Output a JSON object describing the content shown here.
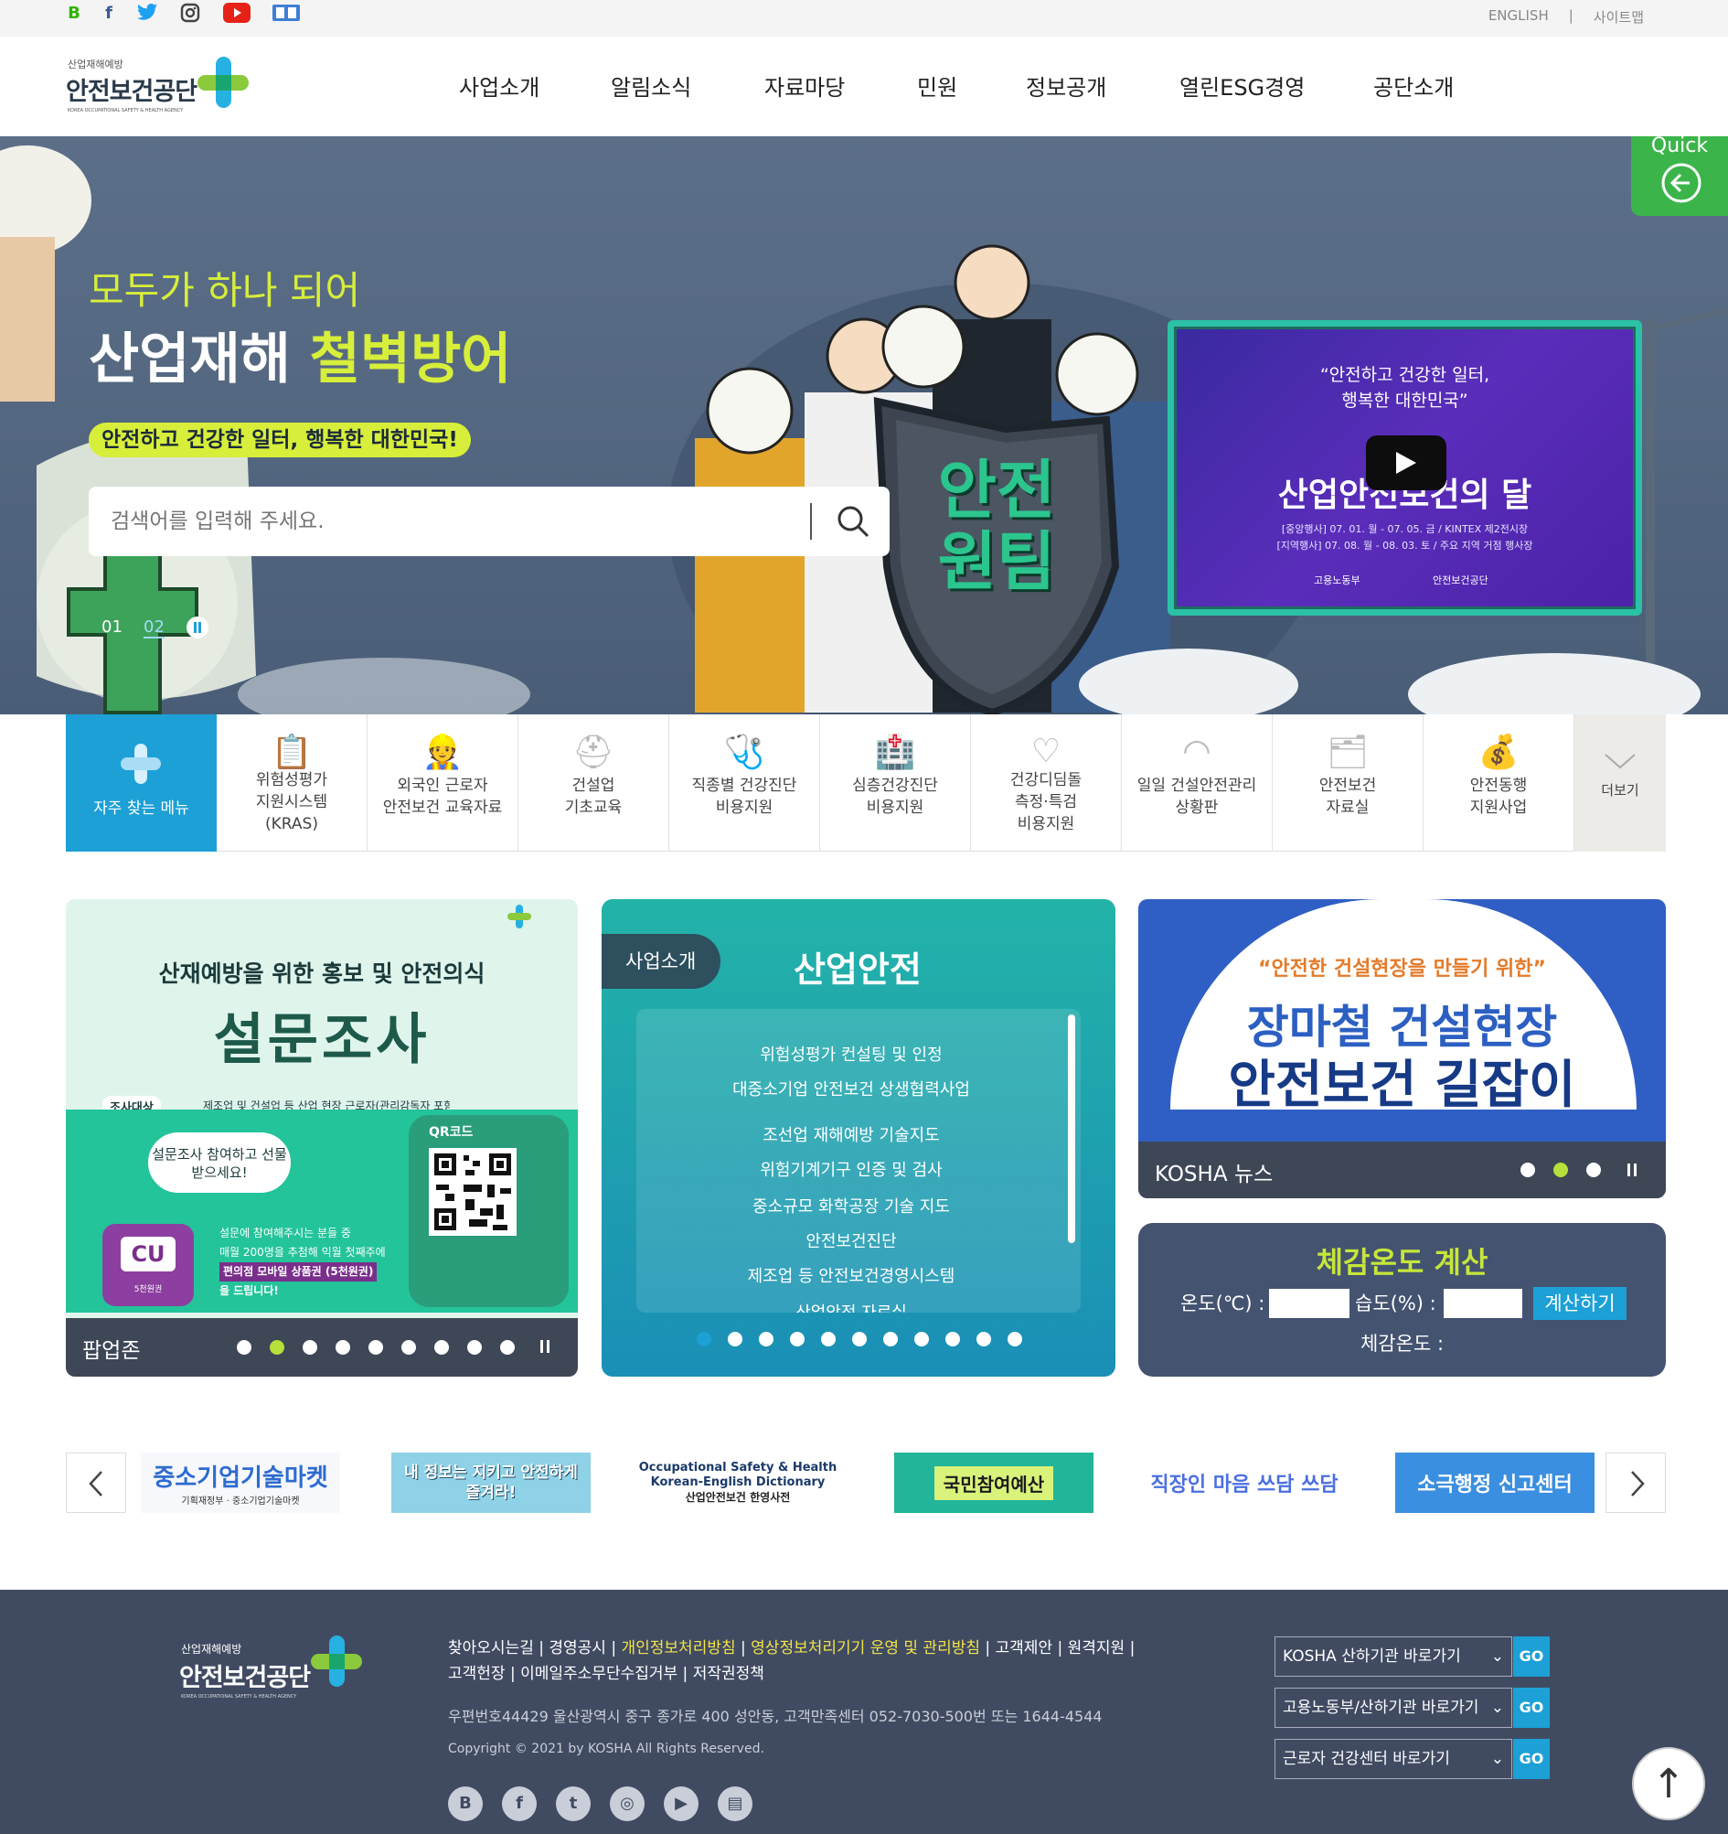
{
  "topbar": {
    "social": [
      {
        "name": "blog",
        "glyph": "B",
        "color": "#2db400"
      },
      {
        "name": "facebook",
        "glyph": "f",
        "color": "#3b5998"
      },
      {
        "name": "twitter",
        "glyph": "t",
        "color": "#1da1f2"
      },
      {
        "name": "instagram",
        "glyph": "◎",
        "color": "#555555"
      },
      {
        "name": "youtube",
        "glyph": "▶",
        "color": "#e62117"
      },
      {
        "name": "book",
        "glyph": "▤",
        "color": "#3f7fd4"
      }
    ],
    "util_links": [
      "ENGLISH",
      "|",
      "사이트맵"
    ]
  },
  "header": {
    "logo_top": "산업재해예방",
    "logo_main": "안전보건공단",
    "logo_en": "KOREA OCCUPATIONAL SAFETY & HEALTH AGENCY",
    "nav": [
      "사업소개",
      "알림소식",
      "자료마당",
      "민원",
      "정보공개",
      "열린ESG경영",
      "공단소개"
    ]
  },
  "hero": {
    "subtitle": "모두가 하나 되어",
    "title_prefix": "산업재해 ",
    "title_highlight": "철벽방어",
    "pill": "안전하고 건강한 일터, 행복한 대한민국!",
    "search_placeholder": "검색어를 입력해 주세요.",
    "slides": [
      "01",
      "02"
    ],
    "active_slide": "02",
    "shield_text_1": "안전",
    "shield_text_2": "원팀",
    "quick_label": "Quick",
    "video": {
      "quote_line1": "“안전하고 건강한 일터,",
      "quote_line2": "행복한 대한민국”",
      "title": "산업안전보건의 달",
      "event1": "[중앙행사] 07. 01. 월 - 07. 05. 금 / KINTEX 제2전시장",
      "event2": "[지역행사] 07. 08. 월 - 08. 03. 토 / 주요 지역 거점 행사장",
      "org1": "고용노동부",
      "org2": "안전보건공단"
    }
  },
  "quickmenu": {
    "head_label": "자주 찾는 메뉴",
    "items": [
      {
        "label": "위험성평가\n지원시스템\n(KRAS)",
        "icon": "clipboard-icon",
        "glyph": "📋"
      },
      {
        "label": "외국인 근로자\n안전보건 교육자료",
        "icon": "foreign-worker-icon",
        "glyph": "👷"
      },
      {
        "label": "건설업\n기초교육",
        "icon": "hardhat-icon",
        "glyph": "⛑"
      },
      {
        "label": "직종별 건강진단\n비용지원",
        "icon": "stethoscope-icon",
        "glyph": "🩺"
      },
      {
        "label": "심층건강진단\n비용지원",
        "icon": "hospital-icon",
        "glyph": "🏥"
      },
      {
        "label": "건강디딤돌\n측정·특검\n비용지원",
        "icon": "heartbeat-icon",
        "glyph": "♡"
      },
      {
        "label": "일일 건설안전관리\n상황판",
        "icon": "gauge-icon",
        "glyph": "◠"
      },
      {
        "label": "안전보건\n자료실",
        "icon": "folder-icon",
        "glyph": "🗂"
      },
      {
        "label": "안전동행\n지원사업",
        "icon": "money-hand-icon",
        "glyph": "💰"
      }
    ],
    "more_label": "더보기"
  },
  "popup": {
    "headline": "산재예방을 위한 홍보 및 안전의식",
    "big_title": "설문조사",
    "survey_tag": "조사대상",
    "desc_partial": "제조업 및 건설업 등 산업 현장 근로자(관리감독자 포함)",
    "qr_label": "QR코드",
    "bubble": "설문조사 참여하고 선물 받으세요!",
    "gift_text_1": "설문에 참여해주시는 분들 중",
    "gift_text_2": "매월 200명을 추첨해 익월 첫째주에",
    "gift_text_3": "편의점 모바일 상품권 (5천원권)",
    "gift_text_4": "을 드립니다!",
    "cu_label": "CU",
    "cu_sub": "5천원권",
    "zone_label": "팝업존",
    "dots": 9,
    "active_dot": 2
  },
  "biz": {
    "tag": "사업소개",
    "title": "산업안전",
    "items": [
      "위험성평가 컨설팅 및 인정",
      "대중소기업 안전보건 상생협력사업",
      "조선업 재해예방 기술지도",
      "위험기계기구 인증 및 검사",
      "중소규모 화학공장 기술 지도",
      "안전보건진단",
      "제조업 등 안전보건경영시스템",
      "산업안전 자료실"
    ],
    "dots": 11,
    "active_dot": 1
  },
  "news": {
    "sub": "“안전한 건설현장을 만들기 위한”",
    "title1": "장마철 건설현장",
    "title2": "안전보건 길잡이",
    "label": "KOSHA 뉴스",
    "dots": 3,
    "active_dot": 2
  },
  "calc": {
    "title": "체감온도 계산",
    "temp_label": "온도(℃) :",
    "humid_label": "습도(%) :",
    "button": "계산하기",
    "result_label": "체감온도 :"
  },
  "banners": [
    {
      "text": "중소기업기술마켓",
      "sub": "기획재정부 · 중소기업기술마켓"
    },
    {
      "text": "내 정보는 지키고 안전하게 즐겨라!",
      "sub": ""
    },
    {
      "text": "Occupational Safety & Health Korean-English Dictionary",
      "sub": "산업안전보건 한영사전"
    },
    {
      "text": "국민참여예산",
      "sub": ""
    },
    {
      "text": "직장인 마음 쓰담 쓰담",
      "sub": ""
    },
    {
      "text": "소극행정 신고센터",
      "sub": ""
    }
  ],
  "footer": {
    "logo_top": "산업재해예방",
    "logo_main": "안전보건공단",
    "logo_en": "KOREA OCCUPATIONAL SAFETY & HEALTH AGENCY",
    "links": [
      "찾아오시는길",
      "경영공시",
      "개인정보처리방침",
      "영상정보처리기기 운영 및 관리방침",
      "고객제안",
      "원격지원",
      "고객헌장",
      "이메일주소무단수집거부",
      "저작권정책"
    ],
    "address": "우편번호44429 울산광역시 중구 종가로 400 성안동, 고객만족센터 052-7030-500번 또는 1644-4544",
    "copyright": "Copyright © 2021 by KOSHA All Rights Reserved.",
    "selects": [
      "KOSHA 산하기관 바로가기",
      "고용노동부/산하기관 바로가기",
      "근로자 건강센터 바로가기"
    ],
    "go_label": "GO",
    "social": [
      "B",
      "f",
      "t",
      "◎",
      "▶",
      "▤"
    ],
    "top_arrow": "↑"
  }
}
